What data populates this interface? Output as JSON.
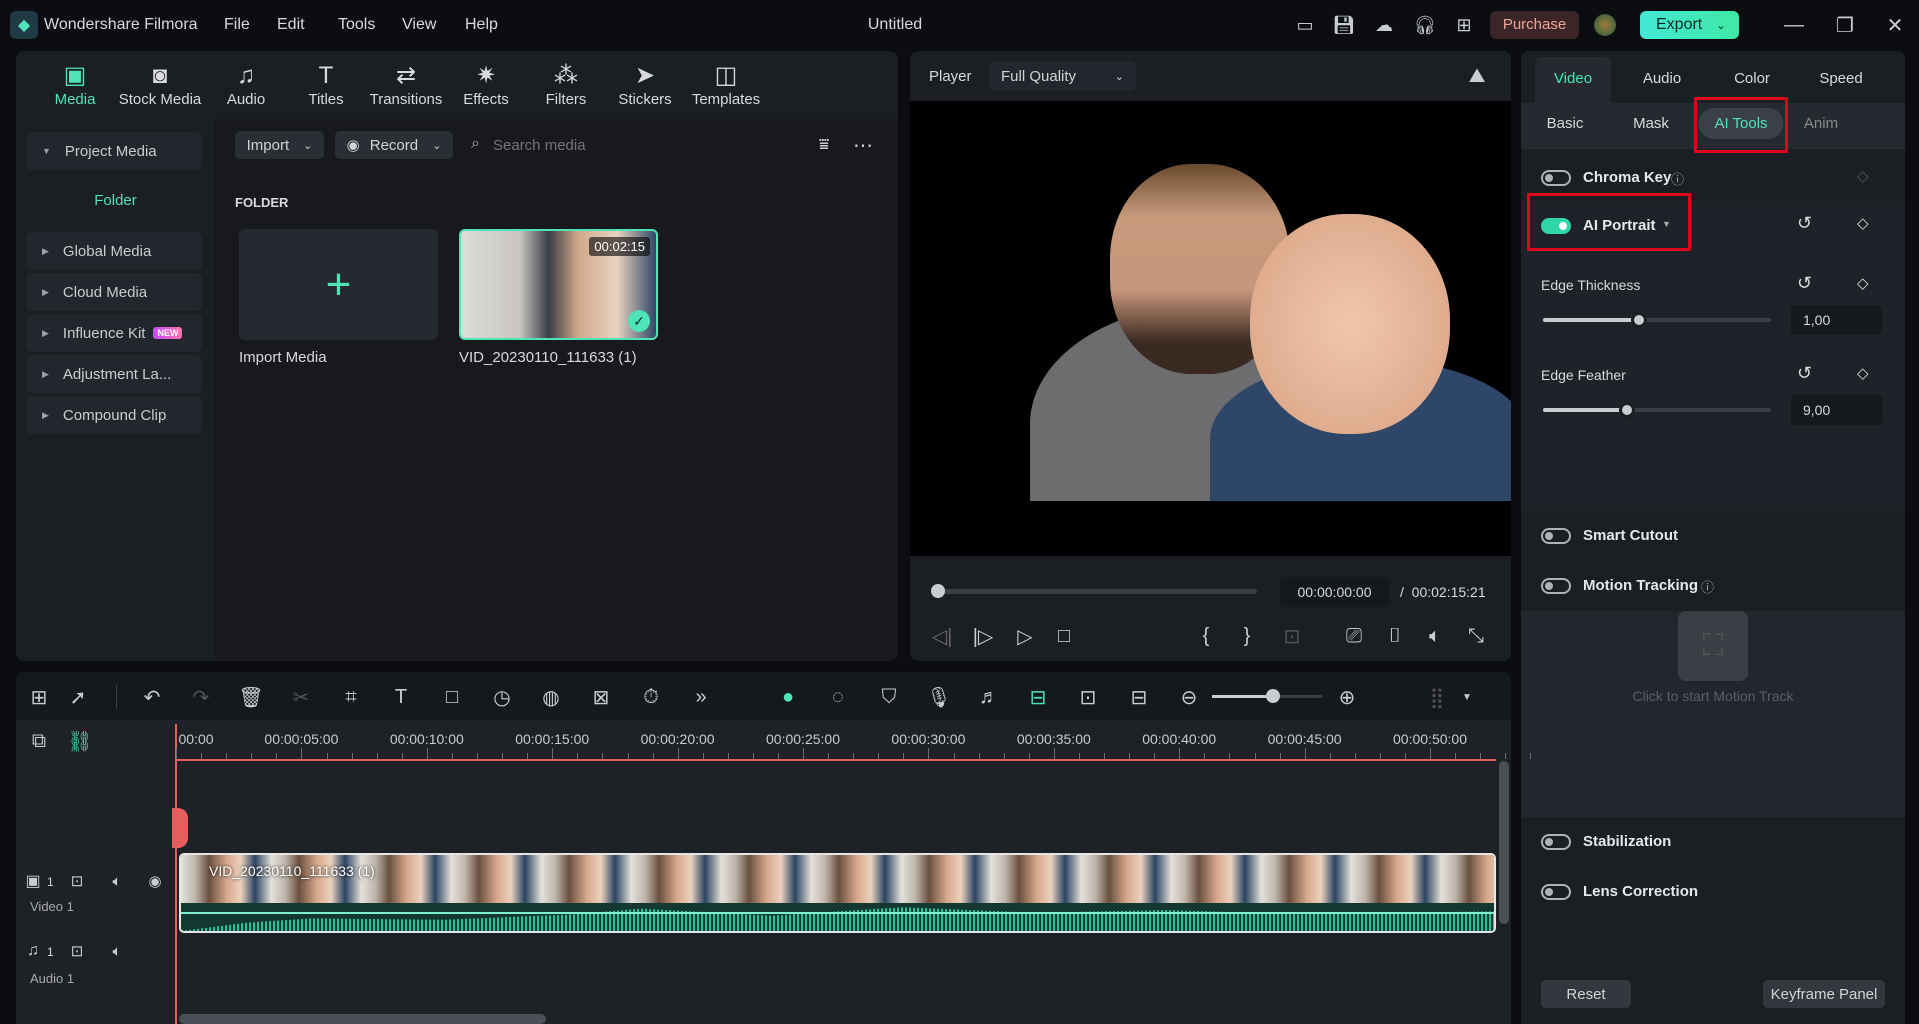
{
  "titlebar": {
    "app_name": "Wondershare Filmora",
    "menus": [
      "File",
      "Edit",
      "Tools",
      "View",
      "Help"
    ],
    "doc_title": "Untitled",
    "purchase": "Purchase",
    "export": "Export",
    "icons": [
      "layout-icon",
      "save-icon",
      "cloud-upload-icon",
      "headset-icon",
      "apps-grid-icon"
    ]
  },
  "top_tabs": [
    {
      "label": "Media",
      "icon": "▣",
      "active": true
    },
    {
      "label": "Stock Media",
      "icon": "◙"
    },
    {
      "label": "Audio",
      "icon": "♫"
    },
    {
      "label": "Titles",
      "icon": "T"
    },
    {
      "label": "Transitions",
      "icon": "⇄"
    },
    {
      "label": "Effects",
      "icon": "✷"
    },
    {
      "label": "Filters",
      "icon": "⁂"
    },
    {
      "label": "Stickers",
      "icon": "➤"
    },
    {
      "label": "Templates",
      "icon": "◫"
    }
  ],
  "sidebar": {
    "project_media": "Project Media",
    "folder": "Folder",
    "items": [
      {
        "label": "Global Media"
      },
      {
        "label": "Cloud Media"
      },
      {
        "label": "Influence Kit",
        "badge": "NEW"
      },
      {
        "label": "Adjustment La..."
      },
      {
        "label": "Compound Clip"
      }
    ]
  },
  "media": {
    "import": "Import",
    "record": "Record",
    "search_placeholder": "Search media",
    "folder_heading": "FOLDER",
    "import_tile_label": "Import Media",
    "clip_label": "VID_20230110_111633 (1)",
    "clip_duration": "00:02:15"
  },
  "player": {
    "label": "Player",
    "quality": "Full Quality",
    "current_time": "00:00:00:00",
    "total_time": "/  00:02:15:21",
    "progress": 0
  },
  "right": {
    "tabs": [
      "Video",
      "Audio",
      "Color",
      "Speed"
    ],
    "active_tab": "Video",
    "subtabs": [
      "Basic",
      "Mask",
      "AI Tools",
      "Anim"
    ],
    "active_subtab": "AI Tools",
    "chroma_key": "Chroma Key",
    "ai_portrait": "AI Portrait",
    "edge_thickness": {
      "label": "Edge Thickness",
      "value": "1,00",
      "fraction": 0.42
    },
    "edge_feather": {
      "label": "Edge Feather",
      "value": "9,00",
      "fraction": 0.37
    },
    "smart_cutout": "Smart Cutout",
    "motion_tracking": "Motion Tracking",
    "motion_hint": "Click to start Motion Track",
    "stabilization": "Stabilization",
    "lens_correction": "Lens Correction",
    "reset": "Reset",
    "keyframe_panel": "Keyframe Panel",
    "toggles": {
      "chroma_key": false,
      "ai_portrait": true,
      "smart_cutout": false,
      "motion_tracking": false,
      "stabilization": false,
      "lens_correction": false
    }
  },
  "timeline": {
    "tools": [
      "multi-select-icon",
      "pointer-icon",
      "|",
      "undo-icon",
      "redo-icon",
      "delete-icon",
      "cut-icon",
      "crop-icon",
      "text-icon",
      "shape-icon",
      "speed-icon",
      "color-palette-icon",
      "portrait-icon",
      "timer-icon",
      "more-icon"
    ],
    "tools_right": [
      "ai-robot-icon",
      "render-icon",
      "marker-icon",
      "microphone-icon",
      "music-list-icon",
      "snap-icon",
      "clip-settings-icon",
      "fit-icon"
    ],
    "ruler": [
      "00:00",
      "00:00:05:00",
      "00:00:10:00",
      "00:00:15:00",
      "00:00:20:00",
      "00:00:25:00",
      "00:00:30:00",
      "00:00:35:00",
      "00:00:40:00",
      "00:00:45:00",
      "00:00:50:00"
    ],
    "video_track": "Video 1",
    "audio_track": "Audio 1",
    "track_num": "1",
    "clip_name": "VID_20230110_111633 (1)",
    "zoom_level": 0.55
  },
  "colors": {
    "accent": "#2fd6a8",
    "playhead": "#e85d5d",
    "highlight": "#e0001b"
  }
}
